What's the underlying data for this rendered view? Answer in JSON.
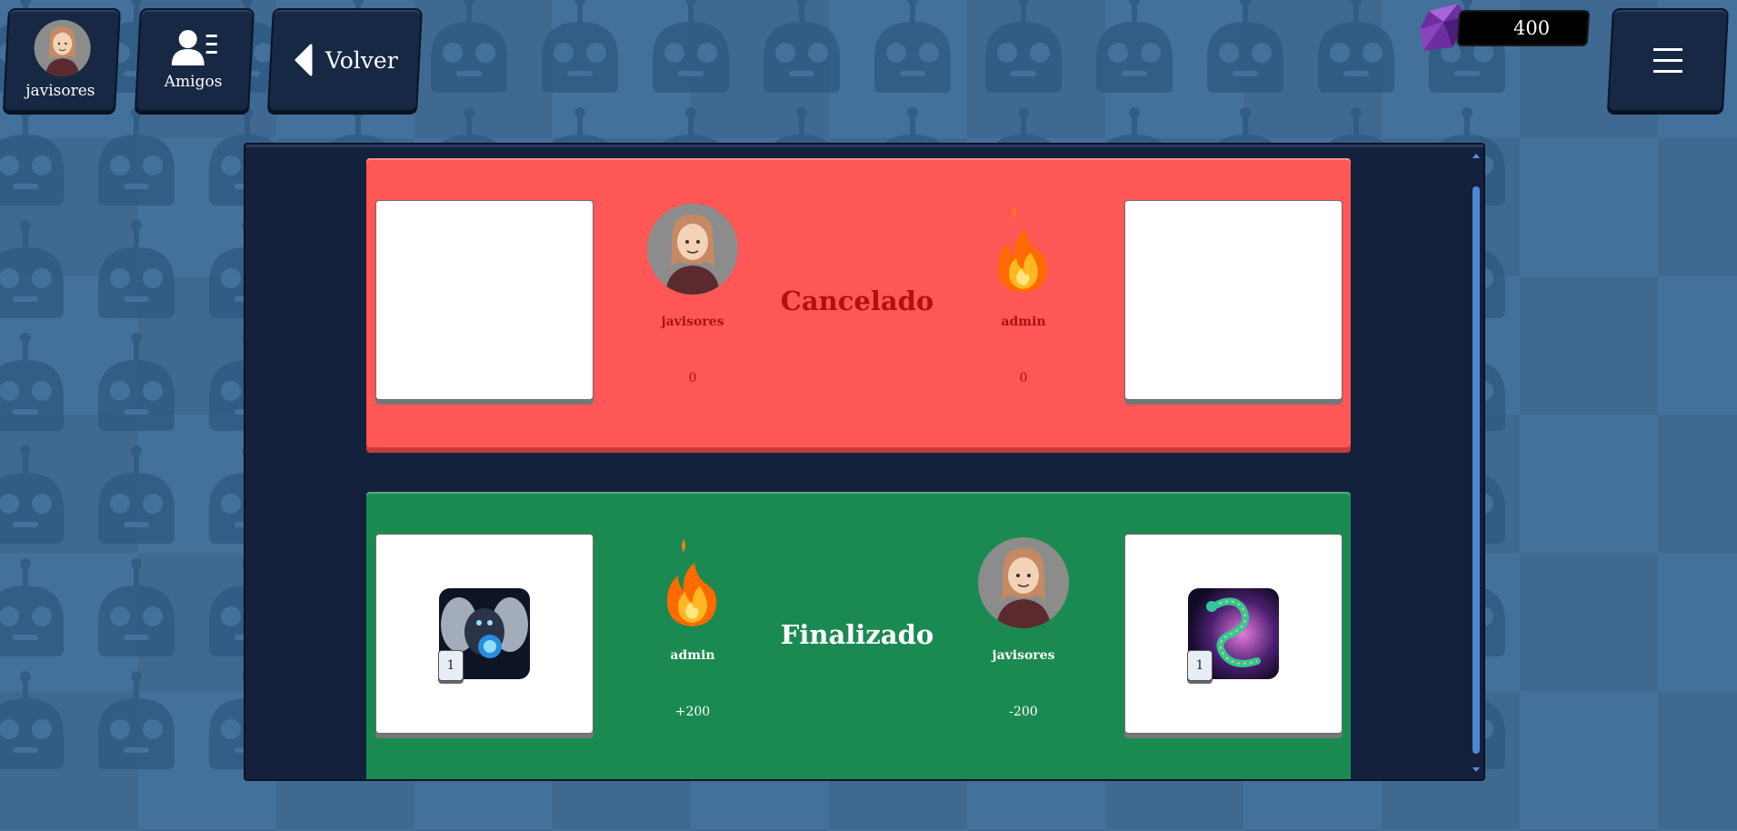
{
  "header": {
    "profile_name": "javisores",
    "friends_label": "Amigos",
    "back_label": "Volver",
    "gems": "400"
  },
  "matches": [
    {
      "status": "Cancelado",
      "left_player": {
        "name": "javisores",
        "score": "0",
        "avatar": "user-avatar"
      },
      "right_player": {
        "name": "admin",
        "score": "0",
        "avatar": "flame-avatar"
      },
      "left_deck": {
        "has_card": false
      },
      "right_deck": {
        "has_card": false
      }
    },
    {
      "status": "Finalizado",
      "left_player": {
        "name": "admin",
        "score": "+200",
        "avatar": "flame-avatar"
      },
      "right_player": {
        "name": "javisores",
        "score": "-200",
        "avatar": "user-avatar"
      },
      "left_deck": {
        "has_card": true,
        "card": "dragon-orb-card",
        "count": "1"
      },
      "right_deck": {
        "has_card": true,
        "card": "serpent-dragon-card",
        "count": "1"
      }
    }
  ],
  "colors": {
    "cancel_bg": "#ff5656",
    "final_bg": "#1b8a52",
    "panel_bg": "#14213d",
    "background": "#44719c"
  }
}
